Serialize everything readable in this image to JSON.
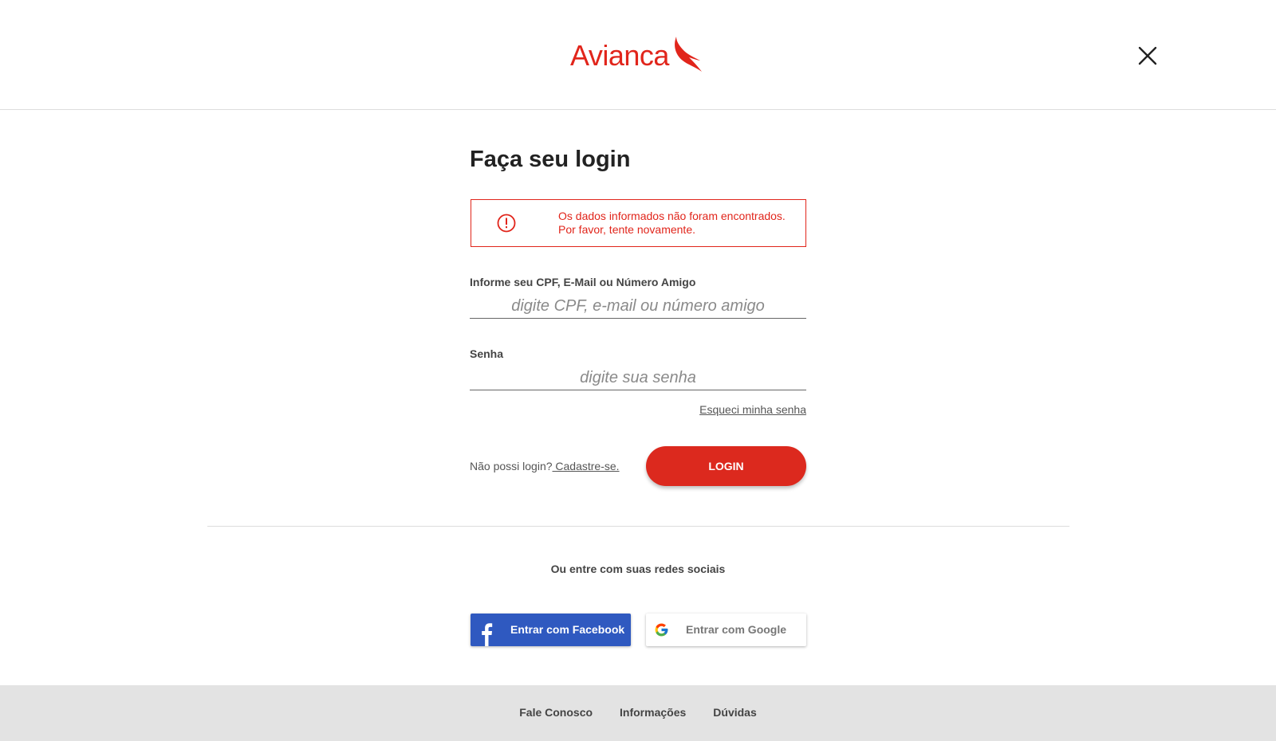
{
  "header": {
    "logo_text": "Avianca",
    "brand_color": "#e1251b",
    "close_icon": "close-icon"
  },
  "login": {
    "title": "Faça seu login",
    "alert": {
      "icon": "exclamation-circle-icon",
      "message": "Os dados informados não foram encontrados. Por favor, tente novamente."
    },
    "user_field": {
      "label": "Informe seu CPF, E-Mail ou Número Amigo",
      "placeholder": "digite CPF, e-mail ou número amigo",
      "value": ""
    },
    "password_field": {
      "label": "Senha",
      "placeholder": "digite sua senha",
      "value": ""
    },
    "forgot_password": "Esqueci minha senha",
    "no_login_text": "Não possi login?",
    "register_link": " Cadastre-se.",
    "login_button": "LOGIN"
  },
  "social": {
    "title": "Ou entre com suas redes sociais",
    "facebook_button": "Entrar com Facebook",
    "google_button": "Entrar com Google",
    "facebook_color": "#2f59c0"
  },
  "footer": {
    "links": [
      "Fale Conosco",
      "Informações",
      "Dúvidas"
    ]
  }
}
